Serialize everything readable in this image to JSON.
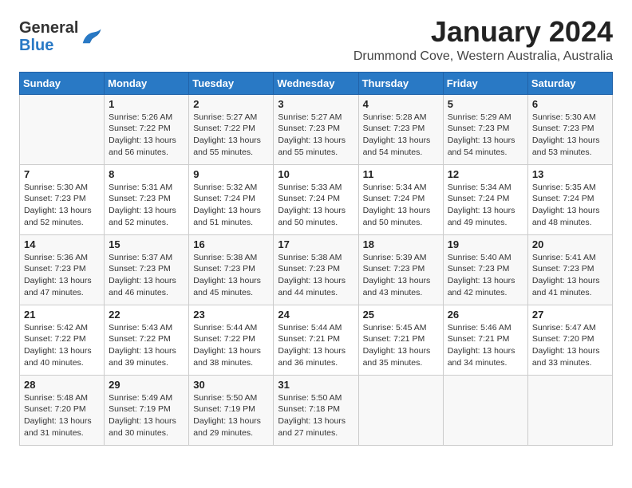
{
  "logo": {
    "general": "General",
    "blue": "Blue"
  },
  "title": "January 2024",
  "location": "Drummond Cove, Western Australia, Australia",
  "weekdays": [
    "Sunday",
    "Monday",
    "Tuesday",
    "Wednesday",
    "Thursday",
    "Friday",
    "Saturday"
  ],
  "weeks": [
    [
      {
        "day": "",
        "lines": []
      },
      {
        "day": "1",
        "lines": [
          "Sunrise: 5:26 AM",
          "Sunset: 7:22 PM",
          "Daylight: 13 hours",
          "and 56 minutes."
        ]
      },
      {
        "day": "2",
        "lines": [
          "Sunrise: 5:27 AM",
          "Sunset: 7:22 PM",
          "Daylight: 13 hours",
          "and 55 minutes."
        ]
      },
      {
        "day": "3",
        "lines": [
          "Sunrise: 5:27 AM",
          "Sunset: 7:23 PM",
          "Daylight: 13 hours",
          "and 55 minutes."
        ]
      },
      {
        "day": "4",
        "lines": [
          "Sunrise: 5:28 AM",
          "Sunset: 7:23 PM",
          "Daylight: 13 hours",
          "and 54 minutes."
        ]
      },
      {
        "day": "5",
        "lines": [
          "Sunrise: 5:29 AM",
          "Sunset: 7:23 PM",
          "Daylight: 13 hours",
          "and 54 minutes."
        ]
      },
      {
        "day": "6",
        "lines": [
          "Sunrise: 5:30 AM",
          "Sunset: 7:23 PM",
          "Daylight: 13 hours",
          "and 53 minutes."
        ]
      }
    ],
    [
      {
        "day": "7",
        "lines": [
          "Sunrise: 5:30 AM",
          "Sunset: 7:23 PM",
          "Daylight: 13 hours",
          "and 52 minutes."
        ]
      },
      {
        "day": "8",
        "lines": [
          "Sunrise: 5:31 AM",
          "Sunset: 7:23 PM",
          "Daylight: 13 hours",
          "and 52 minutes."
        ]
      },
      {
        "day": "9",
        "lines": [
          "Sunrise: 5:32 AM",
          "Sunset: 7:24 PM",
          "Daylight: 13 hours",
          "and 51 minutes."
        ]
      },
      {
        "day": "10",
        "lines": [
          "Sunrise: 5:33 AM",
          "Sunset: 7:24 PM",
          "Daylight: 13 hours",
          "and 50 minutes."
        ]
      },
      {
        "day": "11",
        "lines": [
          "Sunrise: 5:34 AM",
          "Sunset: 7:24 PM",
          "Daylight: 13 hours",
          "and 50 minutes."
        ]
      },
      {
        "day": "12",
        "lines": [
          "Sunrise: 5:34 AM",
          "Sunset: 7:24 PM",
          "Daylight: 13 hours",
          "and 49 minutes."
        ]
      },
      {
        "day": "13",
        "lines": [
          "Sunrise: 5:35 AM",
          "Sunset: 7:24 PM",
          "Daylight: 13 hours",
          "and 48 minutes."
        ]
      }
    ],
    [
      {
        "day": "14",
        "lines": [
          "Sunrise: 5:36 AM",
          "Sunset: 7:23 PM",
          "Daylight: 13 hours",
          "and 47 minutes."
        ]
      },
      {
        "day": "15",
        "lines": [
          "Sunrise: 5:37 AM",
          "Sunset: 7:23 PM",
          "Daylight: 13 hours",
          "and 46 minutes."
        ]
      },
      {
        "day": "16",
        "lines": [
          "Sunrise: 5:38 AM",
          "Sunset: 7:23 PM",
          "Daylight: 13 hours",
          "and 45 minutes."
        ]
      },
      {
        "day": "17",
        "lines": [
          "Sunrise: 5:38 AM",
          "Sunset: 7:23 PM",
          "Daylight: 13 hours",
          "and 44 minutes."
        ]
      },
      {
        "day": "18",
        "lines": [
          "Sunrise: 5:39 AM",
          "Sunset: 7:23 PM",
          "Daylight: 13 hours",
          "and 43 minutes."
        ]
      },
      {
        "day": "19",
        "lines": [
          "Sunrise: 5:40 AM",
          "Sunset: 7:23 PM",
          "Daylight: 13 hours",
          "and 42 minutes."
        ]
      },
      {
        "day": "20",
        "lines": [
          "Sunrise: 5:41 AM",
          "Sunset: 7:23 PM",
          "Daylight: 13 hours",
          "and 41 minutes."
        ]
      }
    ],
    [
      {
        "day": "21",
        "lines": [
          "Sunrise: 5:42 AM",
          "Sunset: 7:22 PM",
          "Daylight: 13 hours",
          "and 40 minutes."
        ]
      },
      {
        "day": "22",
        "lines": [
          "Sunrise: 5:43 AM",
          "Sunset: 7:22 PM",
          "Daylight: 13 hours",
          "and 39 minutes."
        ]
      },
      {
        "day": "23",
        "lines": [
          "Sunrise: 5:44 AM",
          "Sunset: 7:22 PM",
          "Daylight: 13 hours",
          "and 38 minutes."
        ]
      },
      {
        "day": "24",
        "lines": [
          "Sunrise: 5:44 AM",
          "Sunset: 7:21 PM",
          "Daylight: 13 hours",
          "and 36 minutes."
        ]
      },
      {
        "day": "25",
        "lines": [
          "Sunrise: 5:45 AM",
          "Sunset: 7:21 PM",
          "Daylight: 13 hours",
          "and 35 minutes."
        ]
      },
      {
        "day": "26",
        "lines": [
          "Sunrise: 5:46 AM",
          "Sunset: 7:21 PM",
          "Daylight: 13 hours",
          "and 34 minutes."
        ]
      },
      {
        "day": "27",
        "lines": [
          "Sunrise: 5:47 AM",
          "Sunset: 7:20 PM",
          "Daylight: 13 hours",
          "and 33 minutes."
        ]
      }
    ],
    [
      {
        "day": "28",
        "lines": [
          "Sunrise: 5:48 AM",
          "Sunset: 7:20 PM",
          "Daylight: 13 hours",
          "and 31 minutes."
        ]
      },
      {
        "day": "29",
        "lines": [
          "Sunrise: 5:49 AM",
          "Sunset: 7:19 PM",
          "Daylight: 13 hours",
          "and 30 minutes."
        ]
      },
      {
        "day": "30",
        "lines": [
          "Sunrise: 5:50 AM",
          "Sunset: 7:19 PM",
          "Daylight: 13 hours",
          "and 29 minutes."
        ]
      },
      {
        "day": "31",
        "lines": [
          "Sunrise: 5:50 AM",
          "Sunset: 7:18 PM",
          "Daylight: 13 hours",
          "and 27 minutes."
        ]
      },
      {
        "day": "",
        "lines": []
      },
      {
        "day": "",
        "lines": []
      },
      {
        "day": "",
        "lines": []
      }
    ]
  ]
}
